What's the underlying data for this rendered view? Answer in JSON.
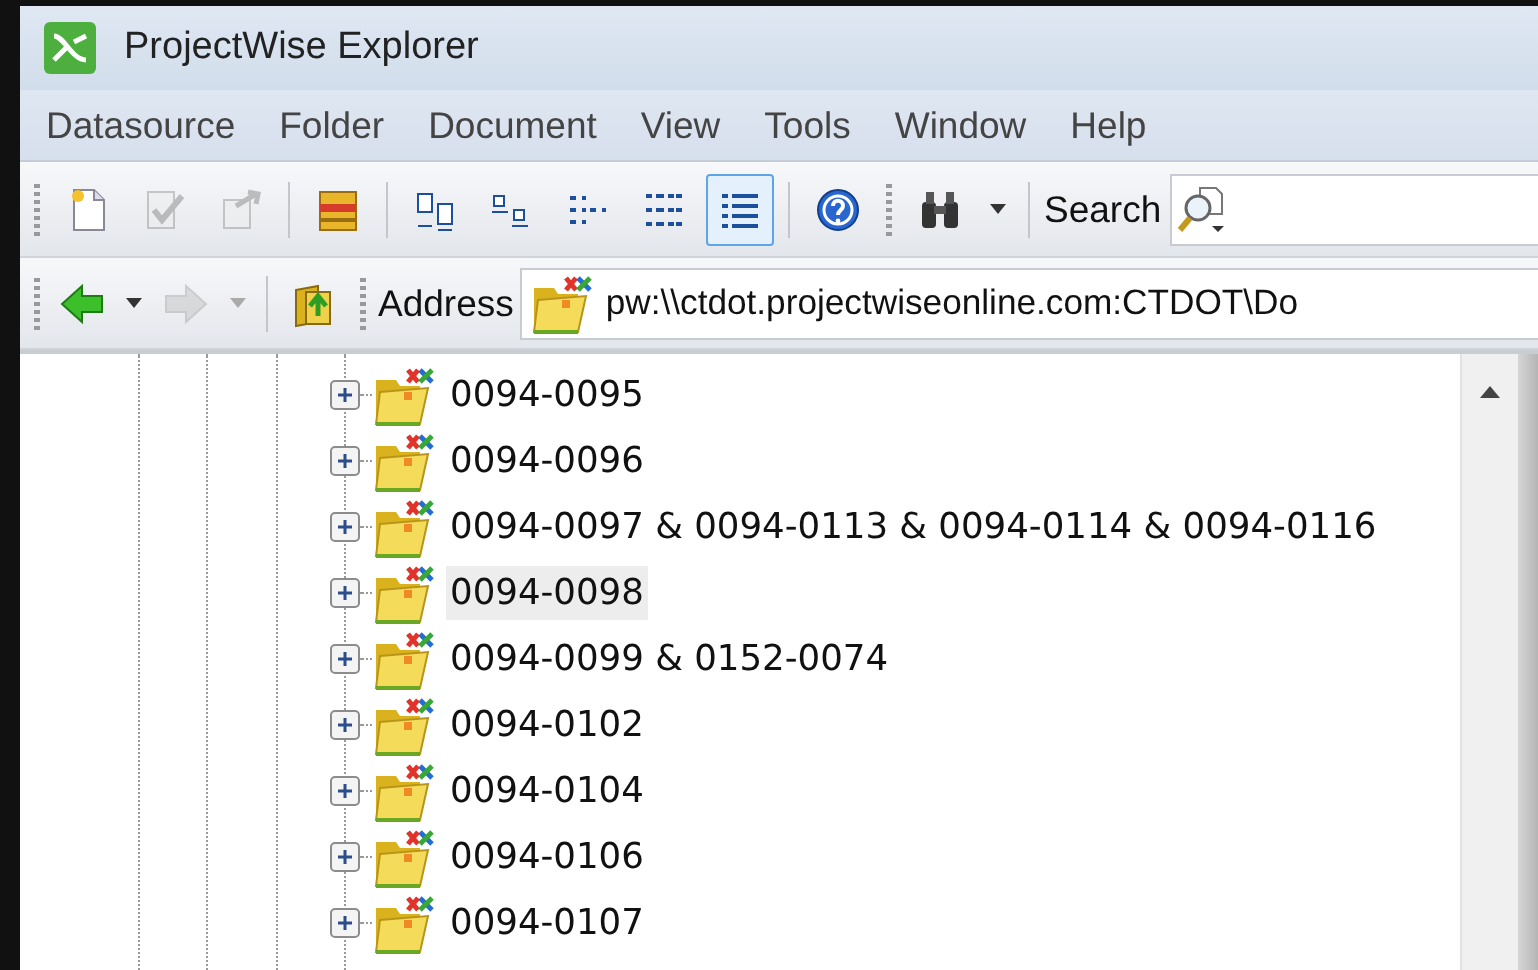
{
  "window": {
    "title": "ProjectWise Explorer"
  },
  "menu": [
    "Datasource",
    "Folder",
    "Document",
    "View",
    "Tools",
    "Window",
    "Help"
  ],
  "toolbar": {
    "checkin": {
      "disabled": true
    },
    "checkout": {
      "disabled": true
    },
    "view_modes": [
      {
        "selected": false
      },
      {
        "selected": false
      },
      {
        "selected": false
      },
      {
        "selected": false
      },
      {
        "selected": true
      }
    ],
    "search_label": "Search"
  },
  "navigation": {
    "back": {
      "disabled": false
    },
    "forward": {
      "disabled": true
    }
  },
  "address_bar": {
    "label": "Address",
    "value": "pw:\\\\ctdot.projectwiseonline.com:CTDOT\\Do"
  },
  "tree": {
    "items": [
      {
        "label": "0094-0095",
        "expanded": false,
        "selected": false
      },
      {
        "label": "0094-0096",
        "expanded": false,
        "selected": false
      },
      {
        "label": "0094-0097 & 0094-0113 & 0094-0114 & 0094-0116",
        "expanded": false,
        "selected": false
      },
      {
        "label": "0094-0098",
        "expanded": false,
        "selected": true
      },
      {
        "label": "0094-0099 & 0152-0074",
        "expanded": false,
        "selected": false
      },
      {
        "label": "0094-0102",
        "expanded": false,
        "selected": false
      },
      {
        "label": "0094-0104",
        "expanded": false,
        "selected": false
      },
      {
        "label": "0094-0106",
        "expanded": false,
        "selected": false
      },
      {
        "label": "0094-0107",
        "expanded": false,
        "selected": false
      }
    ]
  }
}
